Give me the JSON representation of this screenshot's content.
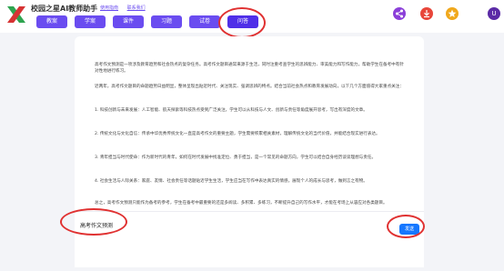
{
  "header": {
    "brand": "校园之星AI教师助手",
    "links": [
      "使用指南",
      "联系我们"
    ],
    "nav": [
      {
        "label": "教案",
        "active": false
      },
      {
        "label": "学案",
        "active": false
      },
      {
        "label": "课件",
        "active": false
      },
      {
        "label": "习题",
        "active": false
      },
      {
        "label": "试卷",
        "active": false
      },
      {
        "label": "问答",
        "active": true
      }
    ],
    "avatar_letter": "U"
  },
  "icons": [
    "logo-x-icon",
    "share-icon",
    "download-icon",
    "star-icon"
  ],
  "colors": {
    "accent": "#6a4cf0",
    "send": "#1677ff",
    "annotation": "#e03131"
  },
  "answer": {
    "paragraphs": [
      "高考作文预测是一项涉及教育趋势和社会热点的复杂任务。高考作文题目通常来源于生活，同时注重考查学生的思辨能力、审美能力和写作能力，帮助学生在备考中有针对性地进行练习。",
      "近两年，高考作文题目的命题趋势日益明显，整体呈现出贴近时代、关注现实、强调思辨的特点。结合当前社会热点和教育发展动向，以下几个方面值得大家重点关注：",
      "1. 科技创新与未来发展：人工智能、航天探索等科技热点受到广泛关注，学生可以从科技与人文、创新与责任等角度展开思考，写出有深度的文章。",
      "2. 传统文化与文化自信：传承中华优秀传统文化一直是高考作文的重要主题，学生需要积累相关素材，理解传统文化的当代价值，并能结合现实进行表达。",
      "3. 青年担当与时代使命：作为新时代的青年，如何在时代发展中找准定位、勇于担当，是一个常见的命题方向，学生可以结合自身经历谈谈理想与责任。",
      "4. 社会生活与人际关系：家庭、友情、社会责任等话题贴近学生生活，学生应当在写作中表达真实的情感，展现个人的成长与思考，做到言之有物。",
      "总之，高考作文预测只能作为备考的参考，学生在备考中最重要的还是多阅读、多积累、多练习，不断提升自己的写作水平，才能在考场上从容应对各类题目。"
    ]
  },
  "composer": {
    "input_value": "高考作文预测",
    "send_label": "发送"
  }
}
